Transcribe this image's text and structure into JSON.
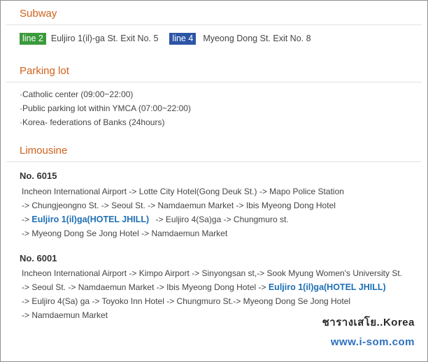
{
  "subway": {
    "title": "Subway",
    "line2_badge": "line 2",
    "line2_exit": "Euljiro 1(il)-ga St. Exit No. 5",
    "line4_badge": "line 4",
    "line4_exit": "Myeong Dong St. Exit No. 8",
    "line2_color": "#3b9a3b",
    "line4_color": "#2c55a6"
  },
  "parking": {
    "title": "Parking lot",
    "items": [
      "·Catholic center (09:00~22:00)",
      "·Public parking lot within YMCA (07:00~22:00)",
      "·Korea- federations of Banks (24hours)"
    ]
  },
  "limousine": {
    "title": "Limousine",
    "routes": [
      {
        "number": "No. 6015",
        "lines": [
          "Incheon International Airport -> Lotte City Hotel(Gong Deuk St.) -> Mapo Police Station",
          "-> Chungjeongno St. -> Seoul St. -> Namdaemun Market -> Ibis Myeong Dong Hotel",
          "->",
          "Euljiro 1(il)ga(HOTEL JHILL)",
          "-> Euljiro 4(Sa)ga -> Chungmuro st.",
          "-> Myeong Dong Se Jong Hotel -> Namdaemun Market"
        ]
      },
      {
        "number": "No. 6001",
        "lines": [
          "Incheon International Airport -> Kimpo Airport -> Sinyongsan st,-> Sook Myung Women's University St.",
          "-> Seoul St. -> Namdaemun Market -> Ibis Myeong Dong Hotel ->",
          "Euljiro 1(il)ga(HOTEL JHILL)",
          "-> Euljiro 4(Sa) ga -> Toyoko Inn Hotel -> Chungmuro St.-> Myeong Dong Se Jong Hotel",
          "-> Namdaemun Market"
        ]
      }
    ],
    "highlight_color": "#1d6fb5"
  },
  "watermark": {
    "thai": "ชารางเสโย..Korea",
    "url": "www.i-som.com"
  },
  "colors": {
    "section_title": "#d0611b",
    "border": "#8f8f8f"
  }
}
